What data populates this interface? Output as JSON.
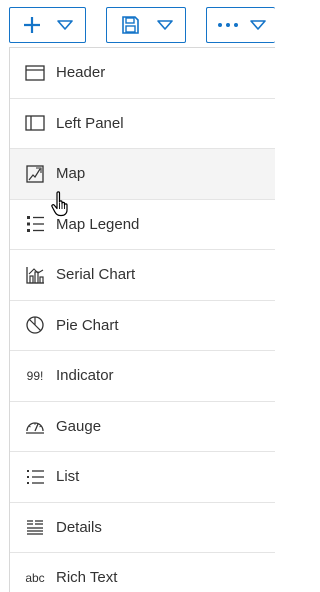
{
  "toolbar": {
    "add_icon": "plus-icon",
    "save_icon": "save-icon",
    "more_icon": "ellipsis-icon",
    "dropdown_icon": "chevron-down-icon",
    "accent_color": "#1474c8"
  },
  "menu": {
    "items": [
      {
        "label": "Header",
        "icon": "header-layout-icon"
      },
      {
        "label": "Left Panel",
        "icon": "left-panel-layout-icon"
      },
      {
        "label": "Map",
        "icon": "map-icon",
        "hover": true
      },
      {
        "label": "Map Legend",
        "icon": "legend-icon"
      },
      {
        "label": "Serial Chart",
        "icon": "serial-chart-icon"
      },
      {
        "label": "Pie Chart",
        "icon": "pie-chart-icon"
      },
      {
        "label": "Indicator",
        "icon": "indicator-icon",
        "icon_text": "99!"
      },
      {
        "label": "Gauge",
        "icon": "gauge-icon"
      },
      {
        "label": "List",
        "icon": "list-icon"
      },
      {
        "label": "Details",
        "icon": "details-icon"
      },
      {
        "label": "Rich Text",
        "icon": "rich-text-icon",
        "icon_text": "abc"
      }
    ]
  }
}
